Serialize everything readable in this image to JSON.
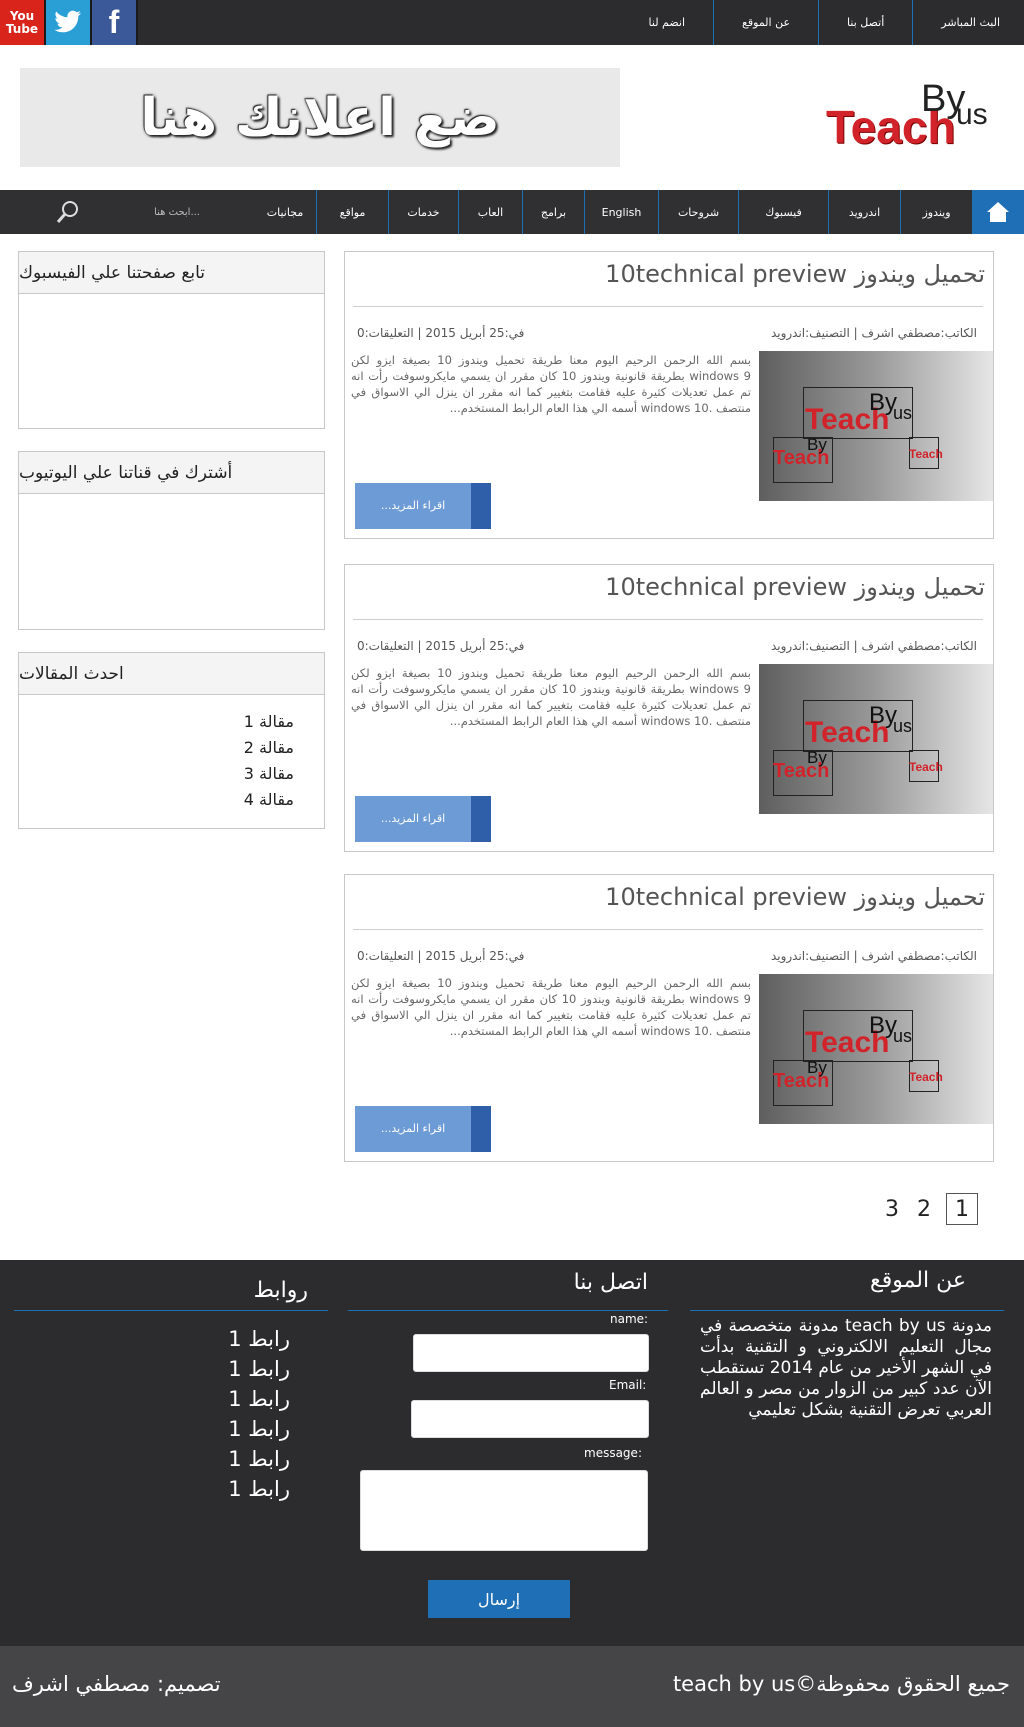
{
  "colors": {
    "accent_blue": "#1e6fb5",
    "top_bar": "#2c2c2e",
    "nav_bar": "#303032",
    "read_more": "#6d9bd6",
    "logo_red": "#d2232a"
  },
  "social": {
    "youtube_label": "You Tube",
    "facebook_letter": "f"
  },
  "top_nav": [
    {
      "label": "البث المباشر"
    },
    {
      "label": "أتصل بنا"
    },
    {
      "label": "عن الموقع"
    },
    {
      "label": "انضم لنا"
    }
  ],
  "ad": {
    "text": "ضع اعلانك هنا"
  },
  "logo": {
    "teach": "Teach",
    "by": "By",
    "us": "us"
  },
  "main_nav": {
    "items": [
      {
        "label": "ويندوز"
      },
      {
        "label": "اندرويد"
      },
      {
        "label": "فيسبوك"
      },
      {
        "label": "شروحات"
      },
      {
        "label": "English"
      },
      {
        "label": "برامج"
      },
      {
        "label": "العاب"
      },
      {
        "label": "خدمات"
      },
      {
        "label": "مواقع"
      },
      {
        "label": "مجانيات"
      }
    ],
    "search_placeholder": "ابحث هنا..."
  },
  "posts": [
    {
      "title": "تحميل ويندوز 10technical preview",
      "author_category": "الكاتب:مصطفي اشرف | التصنيف:اندرويد",
      "date_comments": "في:25 أبريل 2015 | التعليقات:0",
      "excerpt": "بسم الله الرحمن الرحيم اليوم معنا طريقة تحميل ويندوز 10 بصيغة ايزو لكن windows 9 بطريقة قانونية ويندوز 10 كان مقرر ان يسمي مايكروسوفت رأت انه تم عمل تعديلات كثيرة عليه فقامت بتغيير كما انه مقرر ان ينزل الي الاسواق في منتصف .windows 10 أسمه الي هذا العام الرابط المستخدم...",
      "read_more": "اقراء المزيد..."
    },
    {
      "title": "تحميل ويندوز 10technical preview",
      "author_category": "الكاتب:مصطفي اشرف | التصنيف:اندرويد",
      "date_comments": "في:25 أبريل 2015 | التعليقات:0",
      "excerpt": "بسم الله الرحمن الرحيم اليوم معنا طريقة تحميل ويندوز 10 بصيغة ايزو لكن windows 9 بطريقة قانونية ويندوز 10 كان مقرر ان يسمي مايكروسوفت رأت انه تم عمل تعديلات كثيرة عليه فقامت بتغيير كما انه مقرر ان ينزل الي الاسواق في منتصف .windows 10 أسمه الي هذا العام الرابط المستخدم...",
      "read_more": "اقراء المزيد..."
    },
    {
      "title": "تحميل ويندوز 10technical preview",
      "author_category": "الكاتب:مصطفي اشرف | التصنيف:اندرويد",
      "date_comments": "في:25 أبريل 2015 | التعليقات:0",
      "excerpt": "بسم الله الرحمن الرحيم اليوم معنا طريقة تحميل ويندوز 10 بصيغة ايزو لكن windows 9 بطريقة قانونية ويندوز 10 كان مقرر ان يسمي مايكروسوفت رأت انه تم عمل تعديلات كثيرة عليه فقامت بتغيير كما انه مقرر ان ينزل الي الاسواق في منتصف .windows 10 أسمه الي هذا العام الرابط المستخدم...",
      "read_more": "اقراء المزيد..."
    }
  ],
  "sidebar": {
    "facebook_title": "تابع صفحتنا علي الفيسبوك",
    "youtube_title": "أشترك في قناتنا علي اليوتيوب",
    "recent_title": "احدث المقالات",
    "recent_items": [
      "مقالة 1",
      "مقالة 2",
      "مقالة 3",
      "مقالة 4"
    ]
  },
  "pagination": {
    "pages": [
      "1",
      "2",
      "3"
    ],
    "current": "1"
  },
  "footer": {
    "about_title": "عن الموقع",
    "about_text": "مدونة teach by us مدونة متخصصة في مجال التعليم الالكتروني و التقنية بدأت في الشهر الأخير من عام 2014 تستقطب الآن عدد كبير من الزوار من مصر و العالم العربي تعرض التقنية بشكل تعليمي",
    "contact_title": "اتصل بنا",
    "name_label": ":name",
    "email_label": ":Email",
    "message_label": ":message",
    "send_label": "إرسال",
    "links_title": "روابط",
    "links": [
      "رابط 1",
      "رابط 1",
      "رابط 1",
      "رابط 1",
      "رابط 1",
      "رابط 1"
    ],
    "copyright": "جميع الحقوق محفوظة©teach by us",
    "designer": "تصميم: مصطفي اشرف"
  }
}
